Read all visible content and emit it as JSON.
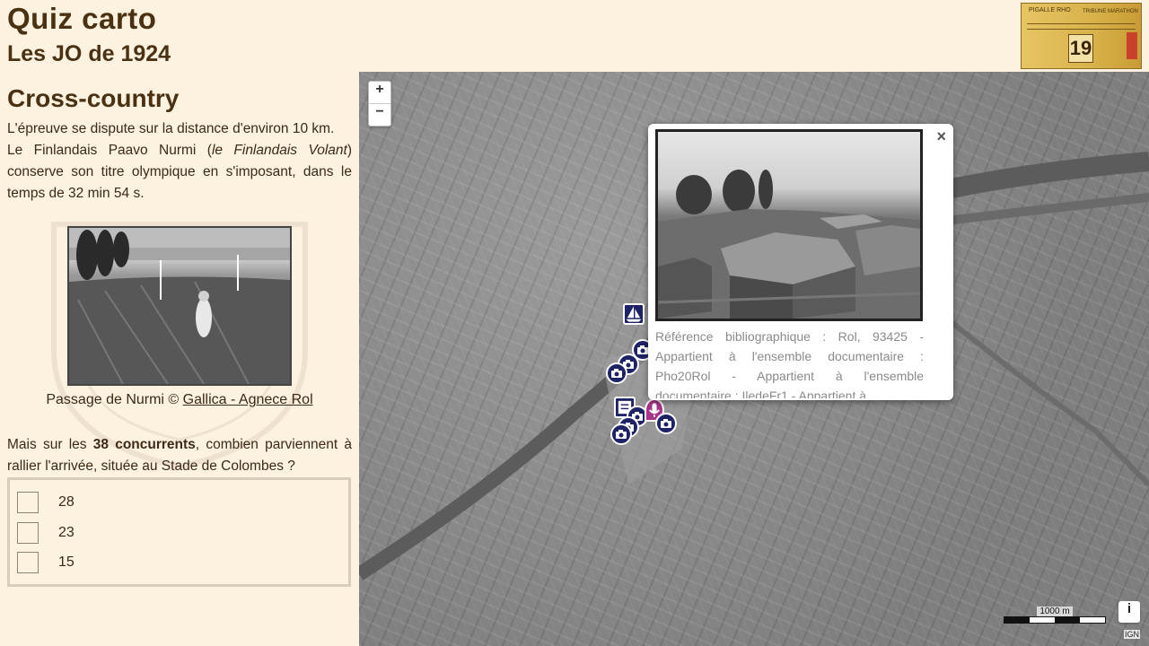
{
  "header": {
    "title": "Quiz carto",
    "subtitle": "Les JO de 1924",
    "ticket": {
      "number": "19",
      "text_left": "PIGALLE RHO",
      "text_right": "TRIBUNE MARATHON"
    }
  },
  "panel": {
    "section_title": "Cross-country",
    "intro_line1": "L'épreuve se dispute sur la distance d'environ 10 km.",
    "intro_p2_a": "Le Finlandais Paavo Nurmi (",
    "intro_p2_em": "le Finlandais Volant",
    "intro_p2_b": ") conserve son titre olympique en s'imposant, dans le temps de 32 min 54 s.",
    "caption_text": "Passage de Nurmi © ",
    "caption_link": "Gallica - Agnece Rol",
    "question_a": "Mais sur les ",
    "question_bold": "38 concurrents",
    "question_b": ", combien parviennent à rallier l'arrivée, située au Stade de Colombes ?",
    "answers": [
      "28",
      "23",
      "15"
    ]
  },
  "map": {
    "zoom_in": "+",
    "zoom_out": "−",
    "popup": {
      "close": "×",
      "reference": "Référence bibliographique : Rol, 93425 - Appartient à l'ensemble documentaire : Pho20Rol - Appartient à l'ensemble documentaire : IledeFr1 - Appartient à"
    },
    "scale_label": "1000 m",
    "info": "i",
    "attribution": "IGN"
  },
  "colors": {
    "marker": "#1e2266",
    "marker_mic": "#a8338a",
    "background": "#fdf1e0",
    "heading": "#4a3112"
  }
}
